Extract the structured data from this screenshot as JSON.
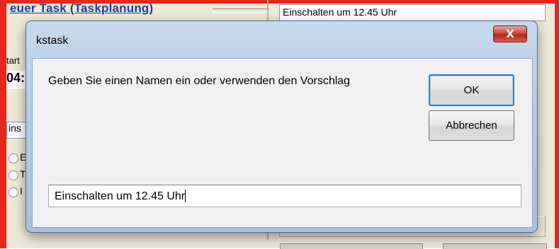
{
  "background_window": {
    "title": "euer Task  (Taskplanung)",
    "right_field_value": "Einschalten um 12.45 Uhr",
    "left_label": "tart",
    "left_bold_value": "04:",
    "left_field_value": "ins",
    "radio_labels": [
      "E",
      "T",
      "I"
    ]
  },
  "dialog": {
    "title": "kstask",
    "close_symbol": "X",
    "prompt": "Geben Sie einen Namen ein oder verwenden den Vorschlag",
    "ok_label": "OK",
    "cancel_label": "Abbrechen",
    "name_value": "Einschalten um 12.45 Uhr"
  },
  "colors": {
    "frame_red": "#e8261c",
    "title_blue": "#1f3d9c",
    "dialog_frame": "#b6cce4",
    "close_red": "#c8372a"
  }
}
